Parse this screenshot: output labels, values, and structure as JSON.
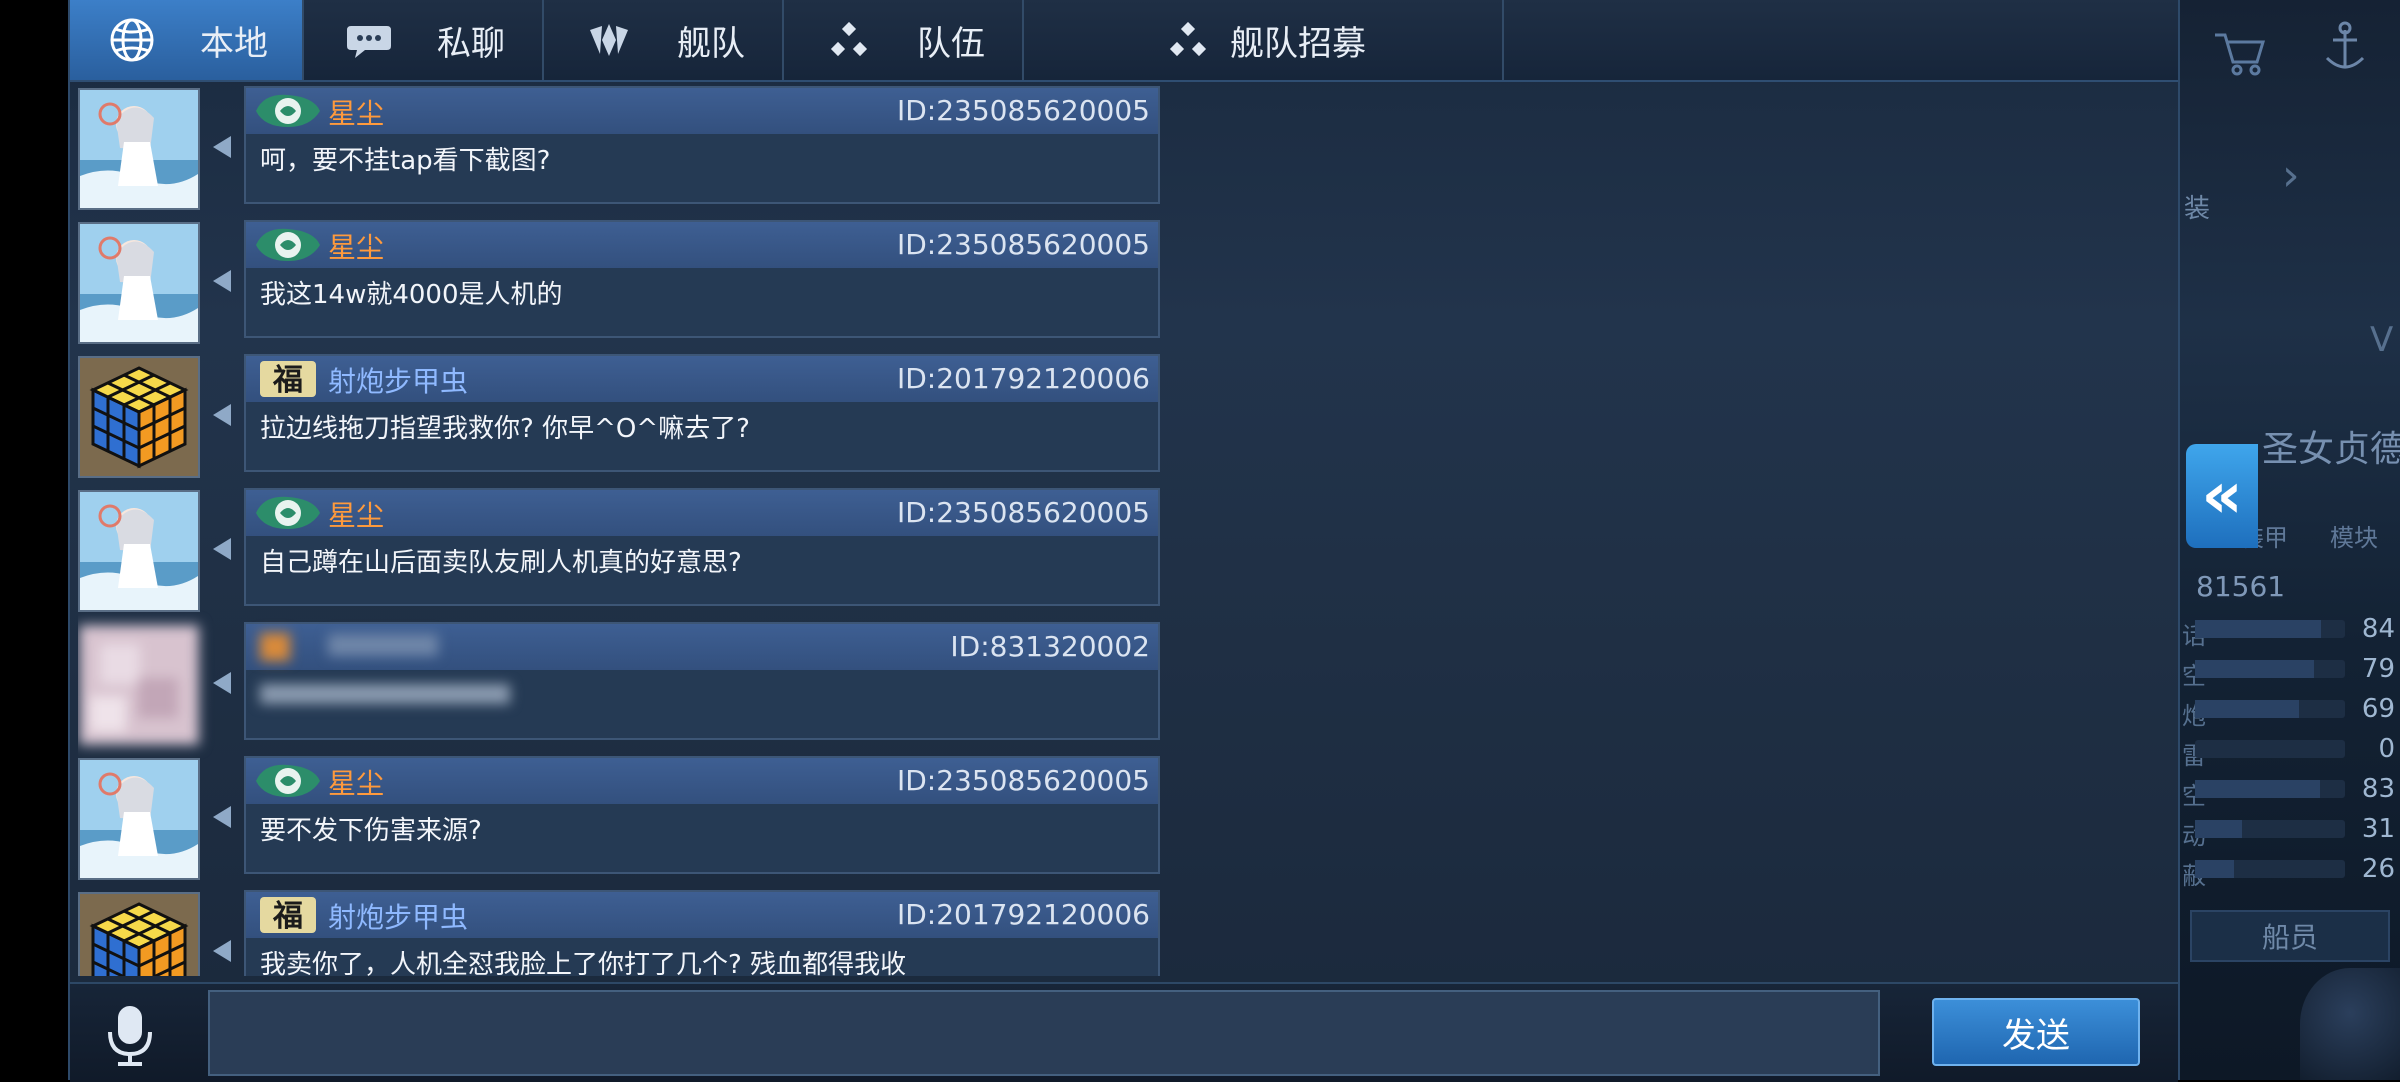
{
  "tabs": [
    {
      "label": "本地",
      "icon": "globe-icon",
      "active": true
    },
    {
      "label": "私聊",
      "icon": "chat-bubble-icon",
      "active": false
    },
    {
      "label": "舰队",
      "icon": "fleet-emblem-icon",
      "active": false
    },
    {
      "label": "队伍",
      "icon": "team-dots-icon",
      "active": false
    },
    {
      "label": "舰队招募",
      "icon": "team-dots-icon",
      "active": false
    }
  ],
  "messages": [
    {
      "name": "星尘",
      "id": "ID:235085620005",
      "text": "呵，要不挂tap看下截图?",
      "avatar": "anime-avatar",
      "badge": "green-emblem",
      "name_color": "orange"
    },
    {
      "name": "星尘",
      "id": "ID:235085620005",
      "text": "我这14w就4000是人机的",
      "avatar": "anime-avatar",
      "badge": "green-emblem",
      "name_color": "orange"
    },
    {
      "name": "射炮步甲虫",
      "id": "ID:201792120006",
      "text": "拉边线拖刀指望我救你? 你早^O^嘛去了?",
      "avatar": "rubiks-cube-avatar",
      "badge": "fu-emblem",
      "name_color": "blue"
    },
    {
      "name": "星尘",
      "id": "ID:235085620005",
      "text": "自己蹲在山后面卖队友刷人机真的好意思?",
      "avatar": "anime-avatar",
      "badge": "green-emblem",
      "name_color": "orange"
    },
    {
      "name": "",
      "id": "ID:831320002",
      "text": "",
      "avatar": "blurred-avatar",
      "badge": "blurred",
      "name_color": "blue"
    },
    {
      "name": "星尘",
      "id": "ID:235085620005",
      "text": "要不发下伤害来源?",
      "avatar": "anime-avatar",
      "badge": "green-emblem",
      "name_color": "orange"
    },
    {
      "name": "射炮步甲虫",
      "id": "ID:201792120006",
      "text": "我卖你了，人机全怼我脸上了你打了几个? 残血都得我收",
      "avatar": "rubiks-cube-avatar",
      "badge": "fu-emblem",
      "name_color": "blue"
    }
  ],
  "input": {
    "placeholder": "",
    "value": ""
  },
  "send_label": "发送",
  "collapse_label": "«",
  "side": {
    "ship_name": "圣女贞德",
    "level_prefix": "V",
    "power": "81561",
    "small_labels": [
      "装甲",
      "模块"
    ],
    "stats": [
      {
        "label": "话",
        "value": "84",
        "fill": 0.84
      },
      {
        "label": "空",
        "value": "79",
        "fill": 0.79
      },
      {
        "label": "炮",
        "value": "69",
        "fill": 0.69
      },
      {
        "label": "雷",
        "value": "0",
        "fill": 0.0
      },
      {
        "label": "空",
        "value": "83",
        "fill": 0.83
      },
      {
        "label": "动",
        "value": "31",
        "fill": 0.31
      },
      {
        "label": "蔽",
        "value": "26",
        "fill": 0.26
      }
    ],
    "crew_label": "船员",
    "side_tag": "装"
  },
  "colors": {
    "accent": "#2a6fb8",
    "name_orange": "#ff9a3c",
    "header_blue": "#3e5f93"
  }
}
